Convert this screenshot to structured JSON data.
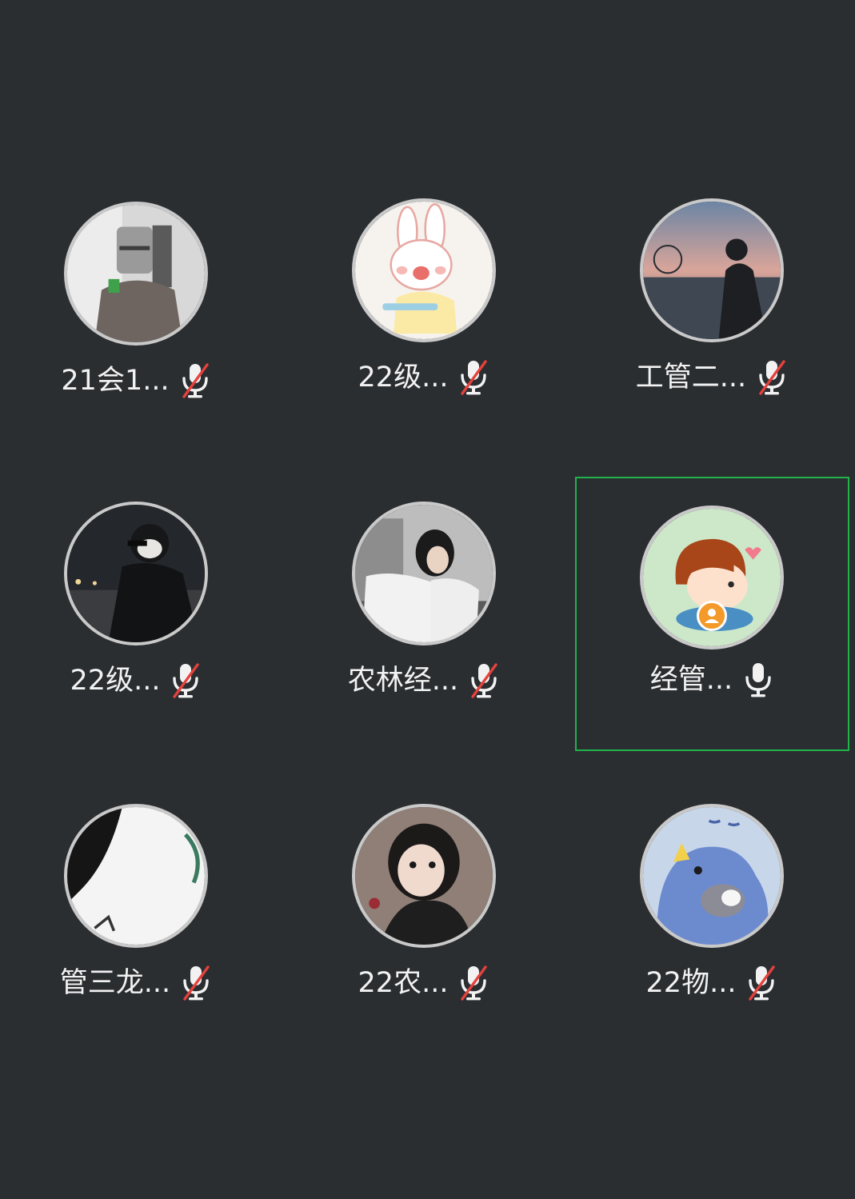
{
  "participants": [
    {
      "name": "21会1...",
      "mic": "muted",
      "avatar": "knight-helmet-photo"
    },
    {
      "name": "22级...",
      "mic": "muted",
      "avatar": "cartoon-bunny"
    },
    {
      "name": "工管二...",
      "mic": "muted",
      "avatar": "sunset-silhouette-photo"
    },
    {
      "name": "22级...",
      "mic": "muted",
      "avatar": "night-portrait-photo"
    },
    {
      "name": "农林经...",
      "mic": "muted",
      "avatar": "girl-portrait-photo"
    },
    {
      "name": "经管...",
      "mic": "active",
      "avatar": "cartoon-boy",
      "speaking": true,
      "host": true
    },
    {
      "name": "管三龙...",
      "mic": "muted",
      "avatar": "monochrome-photo"
    },
    {
      "name": "22农...",
      "mic": "muted",
      "avatar": "child-photo"
    },
    {
      "name": "22物...",
      "mic": "muted",
      "avatar": "blue-dinosaur-cartoon"
    }
  ],
  "colors": {
    "background": "#2b2e31",
    "speaking_border": "#1fb34a",
    "host_badge": "#f39a2b",
    "mute_slash": "#e5413d"
  }
}
